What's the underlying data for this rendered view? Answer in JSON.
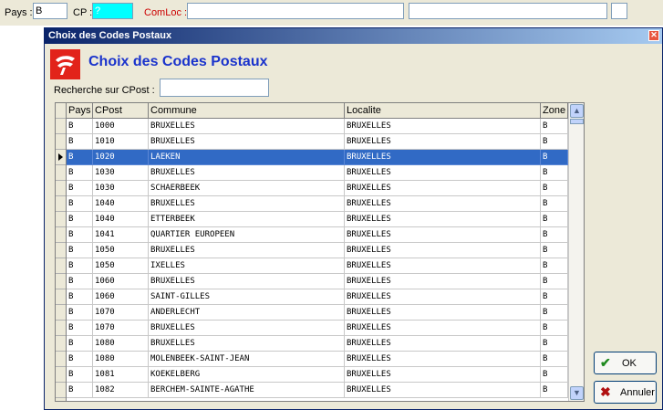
{
  "topbar": {
    "pays_label": "Pays :",
    "pays_value": "B",
    "cp_label": "CP :",
    "cp_value": "?",
    "comloc_label": "ComLoc :"
  },
  "dialog": {
    "title": "Choix des Codes Postaux",
    "heading": "Choix des Codes Postaux",
    "search_label": "Recherche sur CPost :",
    "search_value": "",
    "ok_label": "OK",
    "cancel_label": "Annuler"
  },
  "grid": {
    "columns": [
      "Pays",
      "CPost",
      "Commune",
      "Localite",
      "Zone"
    ],
    "selected_index": 2,
    "rows": [
      [
        "B",
        "1000",
        "BRUXELLES",
        "BRUXELLES",
        "B"
      ],
      [
        "B",
        "1010",
        "BRUXELLES",
        "BRUXELLES",
        "B"
      ],
      [
        "B",
        "1020",
        "LAEKEN",
        "BRUXELLES",
        "B"
      ],
      [
        "B",
        "1030",
        "BRUXELLES",
        "BRUXELLES",
        "B"
      ],
      [
        "B",
        "1030",
        "SCHAERBEEK",
        "BRUXELLES",
        "B"
      ],
      [
        "B",
        "1040",
        "BRUXELLES",
        "BRUXELLES",
        "B"
      ],
      [
        "B",
        "1040",
        "ETTERBEEK",
        "BRUXELLES",
        "B"
      ],
      [
        "B",
        "1041",
        "QUARTIER EUROPEEN",
        "BRUXELLES",
        "B"
      ],
      [
        "B",
        "1050",
        "BRUXELLES",
        "BRUXELLES",
        "B"
      ],
      [
        "B",
        "1050",
        "IXELLES",
        "BRUXELLES",
        "B"
      ],
      [
        "B",
        "1060",
        "BRUXELLES",
        "BRUXELLES",
        "B"
      ],
      [
        "B",
        "1060",
        "SAINT-GILLES",
        "BRUXELLES",
        "B"
      ],
      [
        "B",
        "1070",
        "ANDERLECHT",
        "BRUXELLES",
        "B"
      ],
      [
        "B",
        "1070",
        "BRUXELLES",
        "BRUXELLES",
        "B"
      ],
      [
        "B",
        "1080",
        "BRUXELLES",
        "BRUXELLES",
        "B"
      ],
      [
        "B",
        "1080",
        "MOLENBEEK-SAINT-JEAN",
        "BRUXELLES",
        "B"
      ],
      [
        "B",
        "1081",
        "KOEKELBERG",
        "BRUXELLES",
        "B"
      ],
      [
        "B",
        "1082",
        "BERCHEM-SAINTE-AGATHE",
        "BRUXELLES",
        "B"
      ]
    ]
  },
  "icons": {
    "logo": "post-logo-icon",
    "ok": "checkmark-icon",
    "cancel": "x-icon",
    "close": "close-icon"
  },
  "colors": {
    "selection": "#316ac5",
    "heading": "#1a33cc",
    "cp_field": "#00ffff",
    "comloc_label": "#cc0000"
  }
}
